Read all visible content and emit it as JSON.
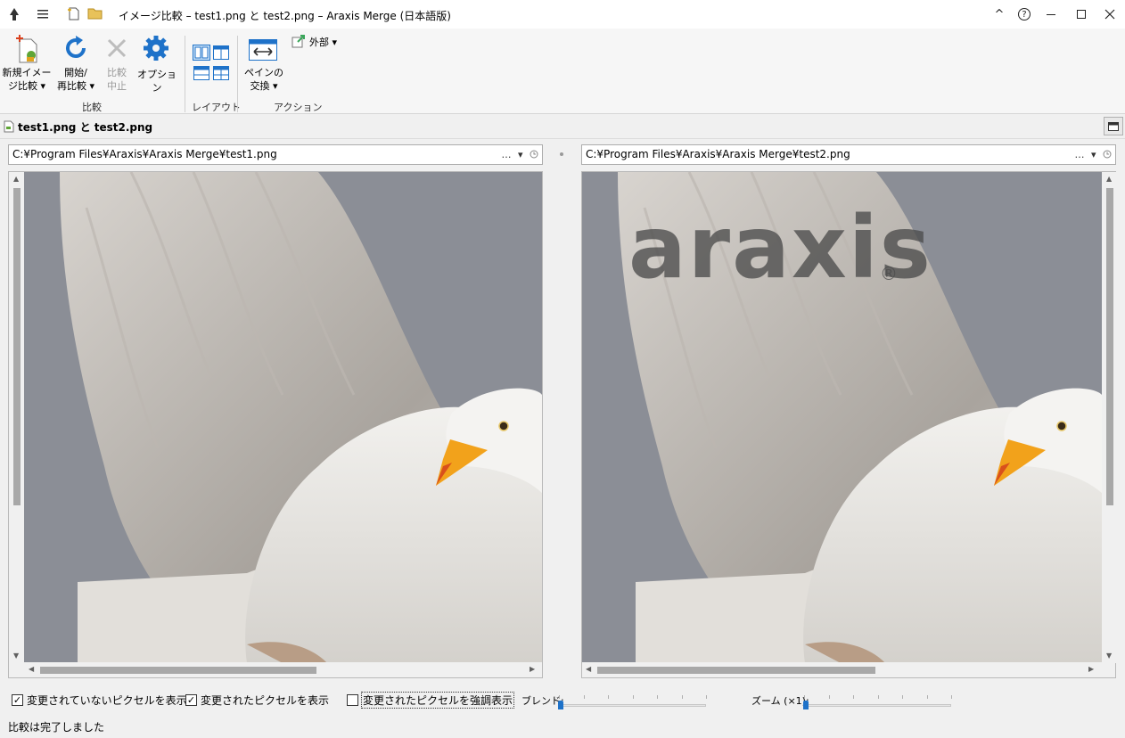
{
  "window": {
    "title": "イメージ比較 – test1.png と test2.png – Araxis Merge (日本語版)",
    "help_glyph": "?",
    "chevron_glyph": "^"
  },
  "ribbon": {
    "new_compare": "新規イメー\nジ比較 ▾",
    "start": "開始/\n再比較 ▾",
    "stop": "比較\n中止",
    "options": "オプション",
    "group_compare": "比較",
    "group_layout": "レイアウト",
    "swap": "ペインの\n交換 ▾",
    "external": "外部 ▾",
    "group_action": "アクション"
  },
  "tab": {
    "label": "test1.png と test2.png"
  },
  "left": {
    "path": "C:¥Program Files¥Araxis¥Araxis Merge¥test1.png"
  },
  "right": {
    "path": "C:¥Program Files¥Araxis¥Araxis Merge¥test2.png"
  },
  "path_tools": "… ▾",
  "watermark": {
    "text": "araxis",
    "mark": "®"
  },
  "options": {
    "show_unchanged": {
      "label": "変更されていないピクセルを表示",
      "checked": true
    },
    "show_changed": {
      "label": "変更されたピクセルを表示",
      "checked": true
    },
    "highlight_changed": {
      "label": "変更されたピクセルを強調表示",
      "checked": false
    }
  },
  "blend": {
    "label": "ブレンド:",
    "value": 0
  },
  "zoom": {
    "label": "ズーム (×1):",
    "value": 0
  },
  "status": "比較は完了しました",
  "colors": {
    "accent": "#1e72c9",
    "sky": "#8b8e96",
    "beak": "#f2a21b"
  }
}
